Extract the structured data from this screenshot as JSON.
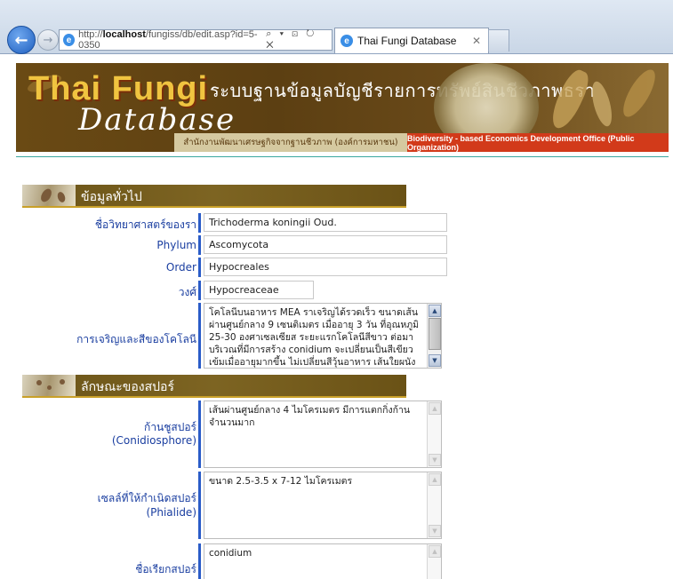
{
  "browser": {
    "url_prefix": "http://",
    "url_host": "localhost",
    "url_path": "/fungiss/db/edit.asp?id=5-0350",
    "address_tools": "⌕ ▾ ⊡ ↻ ✕",
    "tab_title": "Thai Fungi Database",
    "tab_close": "✕"
  },
  "header": {
    "logo_line1": "Thai Fungi",
    "logo_line2": "Database",
    "title": "ระบบฐานข้อมูลบัญชีรายการทรัพย์สินชีวภาพธรา",
    "org_thai": "สำนักงานพัฒนาเศรษฐกิจจากฐานชีวภาพ (องค์การมหาชน)",
    "org_english": "Biodiversity - based Economics Development Office (Public Organization)"
  },
  "sections": {
    "general": "ข้อมูลทั่วไป",
    "spore": "ลักษณะของสปอร์"
  },
  "general": {
    "scientific_name_label": "ชื่อวิทยาศาสตร์ของรา",
    "scientific_name": "Trichoderma koningii  Oud.",
    "phylum_label": "Phylum",
    "phylum": "Ascomycota",
    "order_label": "Order",
    "order": "Hypocreales",
    "family_label": "วงศ์",
    "family": "Hypocreaceae",
    "growth_label": "การเจริญและสีของโคโลนี",
    "growth": "โคโลนีบนอาหาร MEA ราเจริญได้รวดเร็ว ขนาดเส้นผ่านศูนย์กลาง 9 เซนติเมตร เมื่ออายุ 3 วัน ที่อุณหภูมิ 25-30 องศาเซลเซียส ระยะแรกโคโลนีสีขาว ต่อมาบริเวณที่มีการสร้าง conidium จะเปลี่ยนเป็นสีเขียวเข้มเมื่ออายุมากขึ้น ไม่เปลี่ยนสีวุ้นอาหาร เส้นใยผนังเรียบ ไม่มีสี"
  },
  "spore": {
    "conidiophore_label_th": "ก้านชูสปอร์",
    "conidiophore_label_en": "(Conidiosphore)",
    "conidiophore": "เส้นผ่านศูนย์กลาง 4 ไมโครเมตร มีการแตกกิ่งก้านจำนวนมาก",
    "phialide_label_th": "เซลล์ที่ให้กำเนิดสปอร์",
    "phialide_label_en": "(Phialide)",
    "phialide": "ขนาด 2.5-3.5 x 7-12 ไมโครเมตร",
    "spore_name_label": "ชื่อเรียกสปอร์",
    "spore_name": "conidium"
  },
  "icons": {
    "back": "back-arrow-icon",
    "forward": "forward-arrow-icon",
    "ie": "internet-explorer-icon",
    "scroll_up": "scroll-up-icon",
    "scroll_down": "scroll-down-icon"
  },
  "colors": {
    "label_blue": "#1a3ea0",
    "accent_bar": "#2a5cc8",
    "section_brown": "#6b5418",
    "org_red": "#d23a1a"
  }
}
